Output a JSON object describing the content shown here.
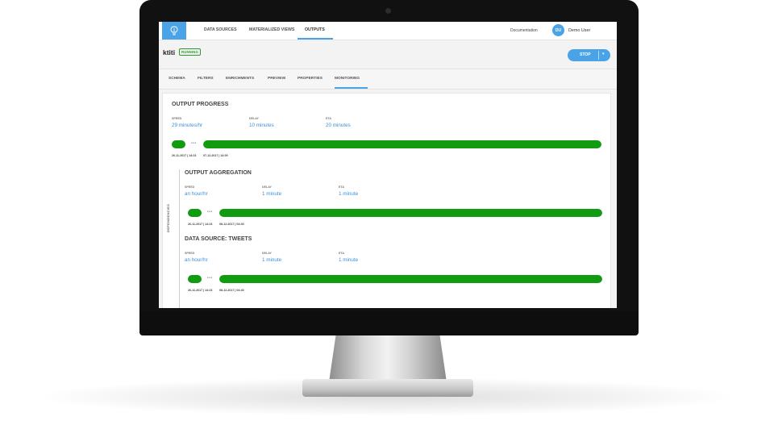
{
  "nav": {
    "tabs": [
      "DATA SOURCES",
      "MATERIALIZED VIEWS",
      "OUTPUTS"
    ],
    "active_tab": "OUTPUTS",
    "documentation": "Documentation",
    "user": {
      "initials": "DU",
      "name": "Demo User"
    }
  },
  "output": {
    "name": "ktiti",
    "status": "RUNNING",
    "stop_label": "STOP"
  },
  "subtabs": [
    "SCHEMA",
    "FILTERS",
    "ENRICHMENTS",
    "PREVIEW",
    "PROPERTIES",
    "MONITORING"
  ],
  "active_subtab": "MONITORING",
  "progress": {
    "title": "OUTPUT PROGRESS",
    "labels": {
      "speed": "SPEED",
      "delay": "DELAY",
      "eta": "ETA"
    },
    "speed": "29 minutes/hr",
    "delay": "10 minutes",
    "eta": "20 minutes",
    "dots": "•••",
    "start_date": "26-11-2017 | 14:23",
    "end_date": "07-12-2017 | 14:00",
    "progress_fraction": 1.0
  },
  "dependencies_label": "DEPENDENCIES",
  "aggregation": {
    "title": "OUTPUT AGGREGATION",
    "speed": "an hour/hr",
    "delay": "1 minute",
    "eta": "1 minute",
    "start_date": "26-11-2017 | 14:23",
    "end_date": "08-12-2017 | 04:40",
    "progress_fraction": 1.0
  },
  "datasource": {
    "title": "DATA SOURCE: TWEETS",
    "speed": "an hour/hr",
    "delay": "1 minute",
    "eta": "1 minute",
    "start_date": "26-11-2017 | 14:23",
    "end_date": "08-12-2017 | 04:40",
    "progress_fraction": 1.0
  },
  "colors": {
    "accent": "#4aa3e6",
    "progress": "#109b10",
    "link": "#3a8fdc"
  },
  "icons": {
    "logo": "brain-icon",
    "caret": "chevron-down-icon"
  }
}
